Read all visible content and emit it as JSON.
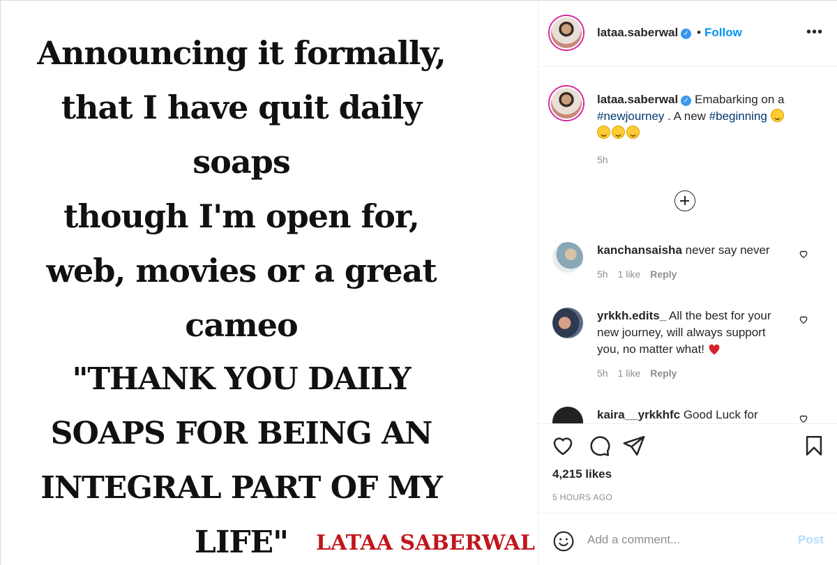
{
  "post": {
    "lines": [
      "Announcing it formally,",
      "that I have quit daily",
      "soaps",
      "though I'm open for,",
      "web, movies or a great",
      "cameo",
      "\"THANK YOU DAILY",
      "SOAPS FOR BEING AN",
      "INTEGRAL PART OF MY",
      "LIFE\""
    ],
    "signature": "LATAA SABERWAL",
    "signature_color": "#c0171c"
  },
  "header": {
    "username": "lataa.saberwal",
    "separator": "•",
    "follow_label": "Follow",
    "more_label": "•••"
  },
  "caption": {
    "username": "lataa.saberwal",
    "text_1": "Emabarking on a",
    "hashtag_1": "#newjourney",
    "text_2": " . A new ",
    "hashtag_2": "#beginning",
    "time": "5h"
  },
  "comments": [
    {
      "username": "kanchansaisha",
      "text": "never say never",
      "time": "5h",
      "likes": "1 like",
      "reply": "Reply"
    },
    {
      "username": "yrkkh.edits_",
      "text": "All the best for your new journey, will always support you, no matter what!",
      "time": "5h",
      "likes": "1 like",
      "reply": "Reply"
    },
    {
      "username": "kaira__yrkkhfc",
      "text": "Good Luck for"
    }
  ],
  "actions": {
    "likes": "4,215 likes",
    "posted_ago": "5 HOURS AGO"
  },
  "add_comment": {
    "placeholder": "Add a comment...",
    "post_label": "Post"
  },
  "colors": {
    "link_blue": "#0095f6",
    "hashtag": "#00376b",
    "muted": "#8e8e8e",
    "post_disabled": "#b2dffc"
  }
}
